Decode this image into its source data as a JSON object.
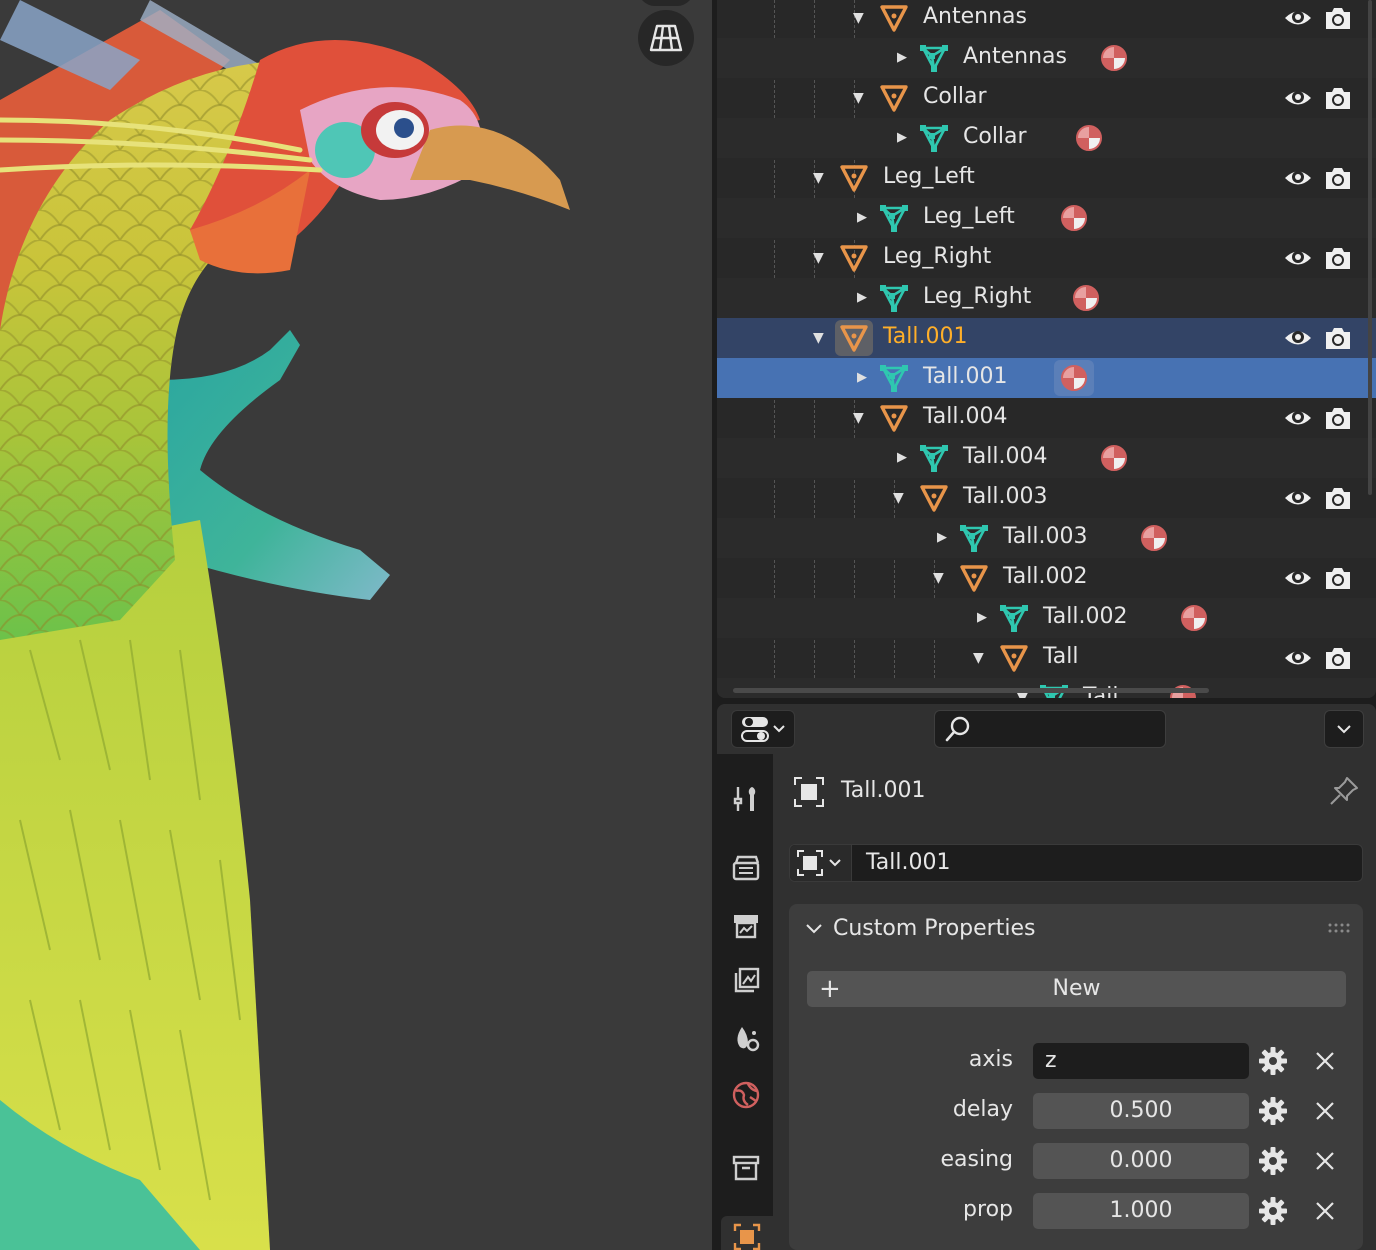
{
  "outliner": {
    "rows": [
      {
        "label": "Antennas",
        "kind": "object",
        "depth": 2,
        "expand": "open"
      },
      {
        "label": "Antennas",
        "kind": "mesh",
        "depth": 3,
        "expand": "closed"
      },
      {
        "label": "Collar",
        "kind": "object",
        "depth": 2,
        "expand": "open"
      },
      {
        "label": "Collar",
        "kind": "mesh",
        "depth": 3,
        "expand": "closed"
      },
      {
        "label": "Leg_Left",
        "kind": "object",
        "depth": 1,
        "expand": "open"
      },
      {
        "label": "Leg_Left",
        "kind": "mesh",
        "depth": 2,
        "expand": "closed"
      },
      {
        "label": "Leg_Right",
        "kind": "object",
        "depth": 1,
        "expand": "open"
      },
      {
        "label": "Leg_Right",
        "kind": "mesh",
        "depth": 2,
        "expand": "closed"
      },
      {
        "label": "Tall.001",
        "kind": "object",
        "depth": 1,
        "expand": "open",
        "state": "active-object"
      },
      {
        "label": "Tall.001",
        "kind": "mesh",
        "depth": 2,
        "expand": "closed",
        "state": "selected"
      },
      {
        "label": "Tall.004",
        "kind": "object",
        "depth": 2,
        "expand": "open"
      },
      {
        "label": "Tall.004",
        "kind": "mesh",
        "depth": 3,
        "expand": "closed"
      },
      {
        "label": "Tall.003",
        "kind": "object",
        "depth": 3,
        "expand": "open"
      },
      {
        "label": "Tall.003",
        "kind": "mesh",
        "depth": 4,
        "expand": "closed"
      },
      {
        "label": "Tall.002",
        "kind": "object",
        "depth": 4,
        "expand": "open"
      },
      {
        "label": "Tall.002",
        "kind": "mesh",
        "depth": 5,
        "expand": "closed"
      },
      {
        "label": "Tall",
        "kind": "object",
        "depth": 5,
        "expand": "open"
      },
      {
        "label": "Tall",
        "kind": "mesh",
        "depth": 6,
        "expand": "open"
      }
    ]
  },
  "properties": {
    "search": {
      "placeholder": ""
    },
    "context": {
      "name": "Tall.001"
    },
    "datablock": {
      "name": "Tall.001"
    },
    "tabs": [
      "tool",
      "render",
      "output",
      "view-layer",
      "scene",
      "world",
      "collection",
      "object"
    ],
    "custom_properties": {
      "title": "Custom Properties",
      "new_label": "New",
      "new_plus": "+",
      "items": [
        {
          "name": "axis",
          "value": "z",
          "kind": "string"
        },
        {
          "name": "delay",
          "value": "0.500",
          "kind": "float"
        },
        {
          "name": "easing",
          "value": "0.000",
          "kind": "float"
        },
        {
          "name": "prop",
          "value": "1.000",
          "kind": "float"
        }
      ]
    }
  },
  "colors": {
    "object_icon": "#e8954a",
    "mesh_icon": "#2fc7b0",
    "active_text": "#ffaf29",
    "selected_row": "#4772b3",
    "active_row": "#334466",
    "material_icon": "#d0605f"
  }
}
